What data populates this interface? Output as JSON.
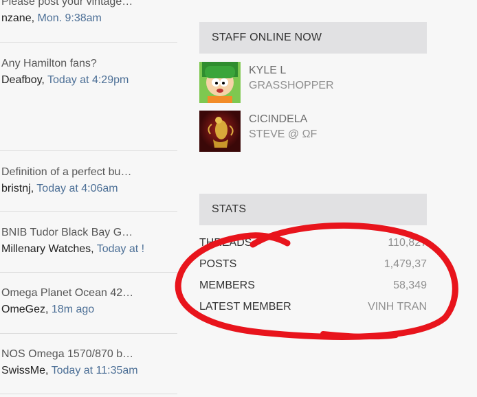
{
  "threads": [
    {
      "title": "Please post your vintage…",
      "user": "nzane",
      "time": "Mon. 9:38am"
    },
    {
      "title": "Any Hamilton fans?",
      "user": "Deafboy",
      "time": "Today at 4:29pm"
    },
    {
      "title": "Definition of a perfect bu…",
      "user": "bristnj",
      "time": "Today at 4:06am"
    },
    {
      "title": "BNIB Tudor Black Bay G…",
      "user": "Millenary Watches",
      "time": "Today at !"
    },
    {
      "title": "Omega Planet Ocean 42…",
      "user": "OmeGez",
      "time": "18m ago"
    },
    {
      "title": "NOS Omega 1570/870 b…",
      "user": "SwissMe",
      "time": "Today at 11:35am"
    }
  ],
  "staff_panel": {
    "heading": "STAFF ONLINE NOW",
    "members": [
      {
        "name": "KYLE L",
        "title": "GRASSHOPPER"
      },
      {
        "name": "CICINDELA",
        "title": "STEVE @ ΩF"
      }
    ]
  },
  "stats_panel": {
    "heading": "STATS",
    "rows": [
      {
        "label": "THREADS",
        "value": "110,827"
      },
      {
        "label": "POSTS",
        "value": "1,479,37"
      },
      {
        "label": "MEMBERS",
        "value": "58,349"
      },
      {
        "label": "LATEST MEMBER",
        "value": "VINH TRAN"
      }
    ]
  },
  "colors": {
    "link": "#4c6f96",
    "annotation": "#e8141c",
    "panel_header": "#e1e1e3"
  }
}
